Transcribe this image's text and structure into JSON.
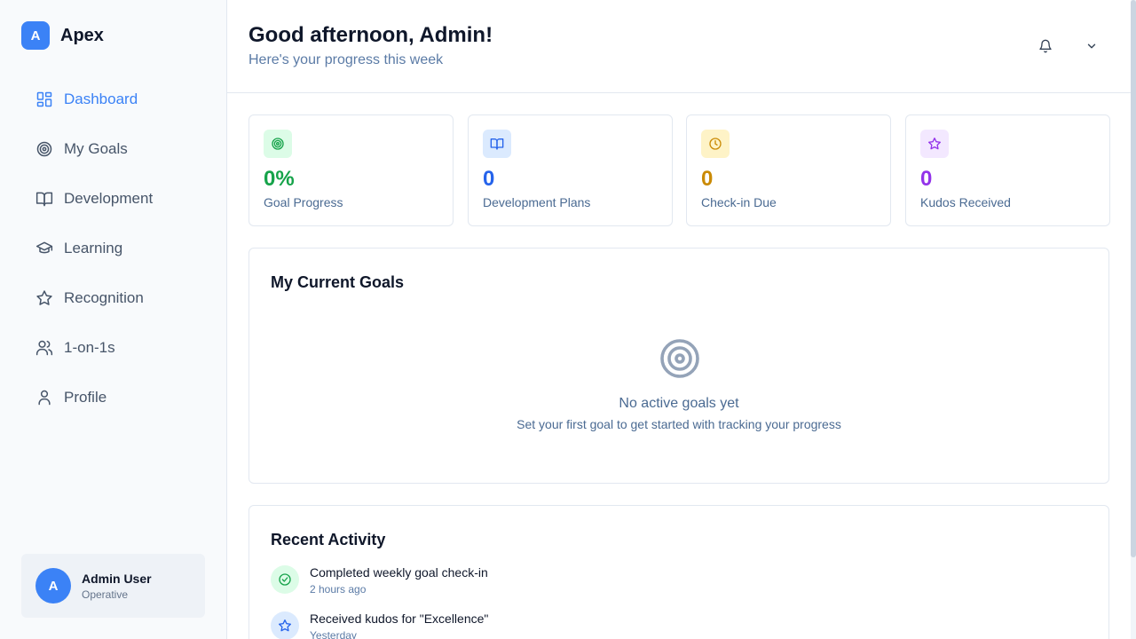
{
  "brand": {
    "logo_letter": "A",
    "name": "Apex"
  },
  "sidebar": {
    "items": [
      {
        "label": "Dashboard",
        "icon": "dashboard-icon",
        "active": true
      },
      {
        "label": "My Goals",
        "icon": "target-icon",
        "active": false
      },
      {
        "label": "Development",
        "icon": "book-open-icon",
        "active": false
      },
      {
        "label": "Learning",
        "icon": "graduation-cap-icon",
        "active": false
      },
      {
        "label": "Recognition",
        "icon": "star-icon",
        "active": false
      },
      {
        "label": "1-on-1s",
        "icon": "users-icon",
        "active": false
      },
      {
        "label": "Profile",
        "icon": "user-icon",
        "active": false
      }
    ]
  },
  "user": {
    "avatar_letter": "A",
    "name": "Admin User",
    "role": "Operative"
  },
  "header": {
    "greeting": "Good afternoon, Admin!",
    "subtitle": "Here's your progress this week",
    "icons": [
      "bell-icon",
      "chevron-down-icon"
    ]
  },
  "stats": [
    {
      "value": "0%",
      "label": "Goal Progress",
      "icon": "target-icon",
      "color": "#16a34a",
      "bg": "#dcfce7"
    },
    {
      "value": "0",
      "label": "Development Plans",
      "icon": "book-open-icon",
      "color": "#2563eb",
      "bg": "#dbeafe"
    },
    {
      "value": "0",
      "label": "Check-in Due",
      "icon": "clock-icon",
      "color": "#ca8a04",
      "bg": "#fef3c7"
    },
    {
      "value": "0",
      "label": "Kudos Received",
      "icon": "star-icon",
      "color": "#9333ea",
      "bg": "#f3e8ff"
    }
  ],
  "goals": {
    "title": "My Current Goals",
    "empty_title": "No active goals yet",
    "empty_subtitle": "Set your first goal to get started with tracking your progress"
  },
  "activity": {
    "title": "Recent Activity",
    "items": [
      {
        "title": "Completed weekly goal check-in",
        "time": "2 hours ago",
        "icon": "check-circle-icon",
        "color": "#16a34a",
        "bg": "#dcfce7"
      },
      {
        "title": "Received kudos for \"Excellence\"",
        "time": "Yesterday",
        "icon": "star-icon",
        "color": "#2563eb",
        "bg": "#dbeafe"
      }
    ]
  },
  "colors": {
    "accent": "#3b82f6",
    "text_muted": "#4a6a92"
  }
}
